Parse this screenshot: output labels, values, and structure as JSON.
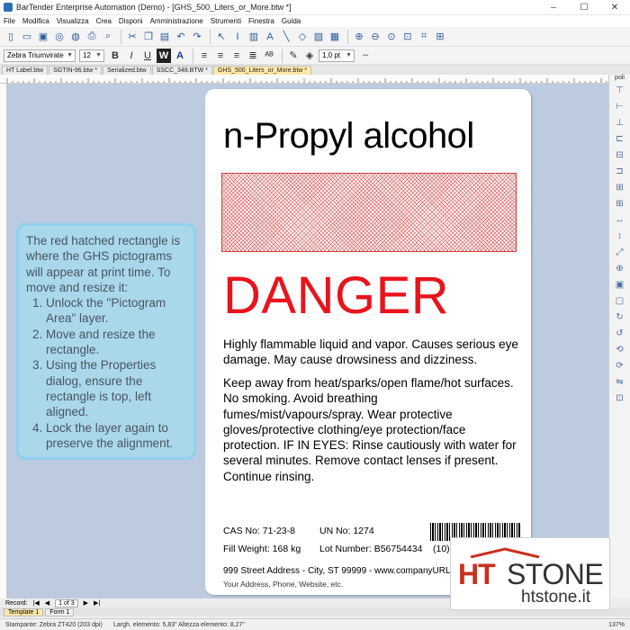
{
  "window": {
    "title": "BarTender Enterprise Automation (Demo) - [GHS_500_Liters_or_More.btw *]",
    "minimize": "–",
    "maximize": "☐",
    "close": "✕"
  },
  "menu": [
    "File",
    "Modifica",
    "Visualizza",
    "Crea",
    "Disponi",
    "Amministrazione",
    "Strumenti",
    "Finestra",
    "Guida"
  ],
  "toolbar_format": {
    "font": "Zebra Triumvirate",
    "size": "12",
    "stroke": "1,0 pt"
  },
  "tabs": [
    {
      "label": "HT Label.btw"
    },
    {
      "label": "SGTIN-96.btw *"
    },
    {
      "label": "Serialized.btw"
    },
    {
      "label": "SSCC_348.BTW *"
    },
    {
      "label": "GHS_500_Liters_or_More.btw *",
      "active": true
    }
  ],
  "right_panel": {
    "top_label": "poli"
  },
  "label": {
    "title": "n-Propyl alcohol",
    "signal_word": "DANGER",
    "hazard_statement": "Highly flammable liquid and vapor. Causes serious eye damage. May cause drowsiness and dizziness.",
    "precautionary_statement": "Keep away from heat/sparks/open flame/hot surfaces.  No smoking.  Avoid breathing fumes/mist/vapours/spray.  Wear protective gloves/protective clothing/eye protection/face protection.  IF IN EYES: Rinse cautiously with water for several minutes.  Remove contact lenses if present.  Continue rinsing.",
    "cas": "CAS No: 71-23-8",
    "un": "UN No: 1274",
    "fill_weight": "Fill Weight: 168 kg",
    "lot": "Lot Number: B56754434",
    "count": "(10)",
    "address": "999 Street Address - City, ST 99999 - www.companyURL",
    "contact": "Your Address, Phone, Website, etc."
  },
  "note": {
    "intro": "The red hatched rectangle is where the GHS pictograms will appear at print time. To move and resize it:",
    "steps": [
      "Unlock the \"Pictogram Area\" layer.",
      "Move and resize the rectangle.",
      "Using the Properties dialog, ensure the rectangle is top, left aligned.",
      "Lock the layer again to preserve the alignment."
    ]
  },
  "bottom_nav": {
    "record": "Record:",
    "page": "1 of 3"
  },
  "layer_tabs": [
    {
      "label": "Template 1",
      "active": true
    },
    {
      "label": "Form 1"
    }
  ],
  "status": {
    "printer": "Stampante: Zebra ZT420 (203 dpi)",
    "size": "Largh. elemento: 5,83\"  Altezza elemento: 8,27\"",
    "zoom": "137%"
  },
  "logo": {
    "ht": "HT",
    "stone": "STONE",
    "site": "htstone.it",
    "accent": "#c8301f"
  },
  "colors": {
    "canvas": "#bccbdf",
    "danger": "#e8141c",
    "note_bg": "#a9d8ea",
    "active_tab": "#ffe9a8"
  }
}
